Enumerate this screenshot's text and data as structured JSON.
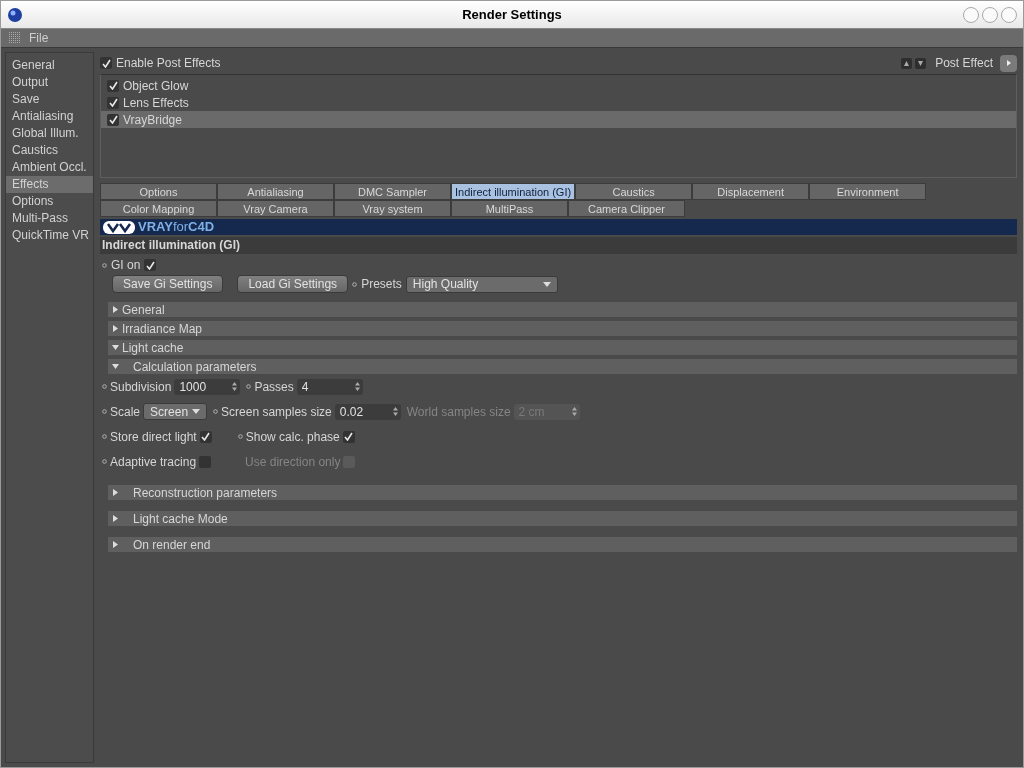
{
  "window": {
    "title": "Render Settings"
  },
  "menu": [
    "File"
  ],
  "sidebar": {
    "items": [
      {
        "label": "General",
        "selected": false
      },
      {
        "label": "Output",
        "selected": false
      },
      {
        "label": "Save",
        "selected": false
      },
      {
        "label": "Antialiasing",
        "selected": false
      },
      {
        "label": "Global Illum.",
        "selected": false
      },
      {
        "label": "Caustics",
        "selected": false
      },
      {
        "label": "Ambient Occl.",
        "selected": false
      },
      {
        "label": "Effects",
        "selected": true
      },
      {
        "label": "Options",
        "selected": false
      },
      {
        "label": "Multi-Pass",
        "selected": false
      },
      {
        "label": "QuickTime VR",
        "selected": false
      }
    ]
  },
  "post_effects": {
    "enable": {
      "label": "Enable Post Effects",
      "checked": true
    },
    "menu_label": "Post Effect",
    "effects": [
      {
        "label": "Object Glow",
        "checked": true,
        "selected": false
      },
      {
        "label": "Lens Effects",
        "checked": true,
        "selected": false
      },
      {
        "label": "VrayBridge",
        "checked": true,
        "selected": true
      }
    ]
  },
  "tab_rows": [
    {
      "tabs": [
        {
          "label": "Options",
          "selected": false
        },
        {
          "label": "Antialiasing",
          "selected": false
        },
        {
          "label": "DMC Sampler",
          "selected": false
        },
        {
          "label": "Indirect illumination (GI)",
          "selected": true
        },
        {
          "label": "Caustics",
          "selected": false
        },
        {
          "label": "Displacement",
          "selected": false
        },
        {
          "label": "Environment",
          "selected": false
        }
      ]
    },
    {
      "tabs": [
        {
          "label": "Color Mapping",
          "selected": false
        },
        {
          "label": "Vray Camera",
          "selected": false
        },
        {
          "label": "Vray system",
          "selected": false
        },
        {
          "label": "MultiPass",
          "selected": false
        },
        {
          "label": "Camera Clipper",
          "selected": false
        }
      ]
    }
  ],
  "logo": "**VRAY**for**C4D**",
  "section_title": "Indirect illumination (GI)",
  "gi_on": {
    "label": "GI on",
    "checked": true
  },
  "buttons": [
    "Save Gi Settings",
    "Load Gi Settings"
  ],
  "presets": {
    "label": "Presets",
    "value": "High Quality"
  },
  "groups": [
    {
      "kind": "group",
      "label": "General",
      "expanded": false
    },
    {
      "kind": "group",
      "label": "Irradiance Map",
      "expanded": false
    },
    {
      "kind": "group",
      "label": "Light cache",
      "expanded": true,
      "children": [
        {
          "kind": "group",
          "label": "Calculation parameters",
          "expanded": true,
          "children": [
            {
              "kind": "fields",
              "fields": [
                {
                  "kind": "number",
                  "label": "Subdivision",
                  "value": "1000",
                  "disabled": false
                },
                {
                  "kind": "number",
                  "label": "Passes",
                  "value": "4",
                  "disabled": false
                }
              ]
            },
            {
              "kind": "fields",
              "fields": [
                {
                  "kind": "dropdown",
                  "label": "Scale",
                  "value": "Screen",
                  "disabled": false
                },
                {
                  "kind": "number",
                  "label": "Screen samples size",
                  "value": "0.02",
                  "disabled": false
                },
                {
                  "kind": "number",
                  "label": "World samples size",
                  "value": "2 cm",
                  "disabled": true
                }
              ]
            },
            {
              "kind": "fields",
              "fields": [
                {
                  "kind": "checkbox",
                  "label": "Store direct light",
                  "checked": true,
                  "disabled": false
                },
                {
                  "kind": "checkbox",
                  "label": "Show calc. phase",
                  "checked": true,
                  "disabled": false
                }
              ]
            },
            {
              "kind": "fields",
              "fields": [
                {
                  "kind": "checkbox",
                  "label": "Adaptive tracing",
                  "checked": false,
                  "disabled": false
                },
                {
                  "kind": "checkbox",
                  "label": "Use direction only",
                  "checked": false,
                  "disabled": true
                }
              ]
            }
          ]
        },
        {
          "kind": "group",
          "label": "Reconstruction parameters",
          "expanded": false
        },
        {
          "kind": "group",
          "label": "Light cache Mode",
          "expanded": false
        },
        {
          "kind": "group",
          "label": "On render end",
          "expanded": false
        }
      ]
    }
  ]
}
